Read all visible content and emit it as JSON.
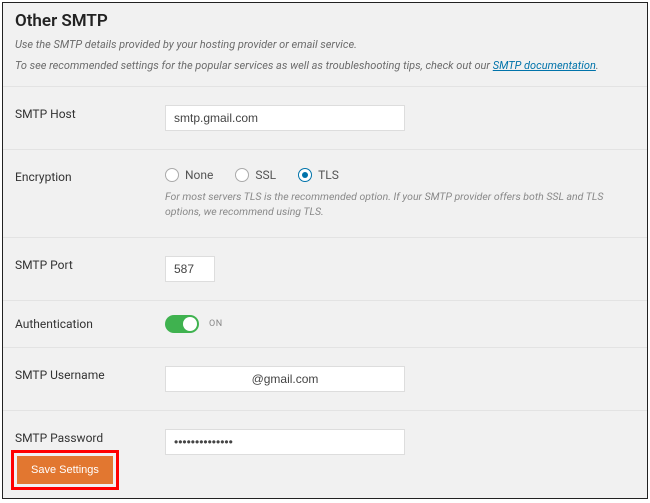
{
  "header": {
    "title": "Other SMTP",
    "intro1": "Use the SMTP details provided by your hosting provider or email service.",
    "intro2_pre": "To see recommended settings for the popular services as well as troubleshooting tips, check out our ",
    "doc_link_text": "SMTP documentation",
    "intro2_post": "."
  },
  "fields": {
    "host": {
      "label": "SMTP Host",
      "value": "smtp.gmail.com"
    },
    "encryption": {
      "label": "Encryption",
      "options": {
        "none": "None",
        "ssl": "SSL",
        "tls": "TLS"
      },
      "selected": "tls",
      "hint": "For most servers TLS is the recommended option. If your SMTP provider offers both SSL and TLS options, we recommend using TLS."
    },
    "port": {
      "label": "SMTP Port",
      "value": "587"
    },
    "auth": {
      "label": "Authentication",
      "state_label": "ON",
      "on": true
    },
    "username": {
      "label": "SMTP Username",
      "value": "@gmail.com"
    },
    "password": {
      "label": "SMTP Password",
      "value": "••••••••••••••"
    }
  },
  "buttons": {
    "save": "Save Settings"
  },
  "colors": {
    "accent": "#0073aa",
    "toggle_on": "#3fb24f",
    "primary_btn": "#e27730"
  }
}
